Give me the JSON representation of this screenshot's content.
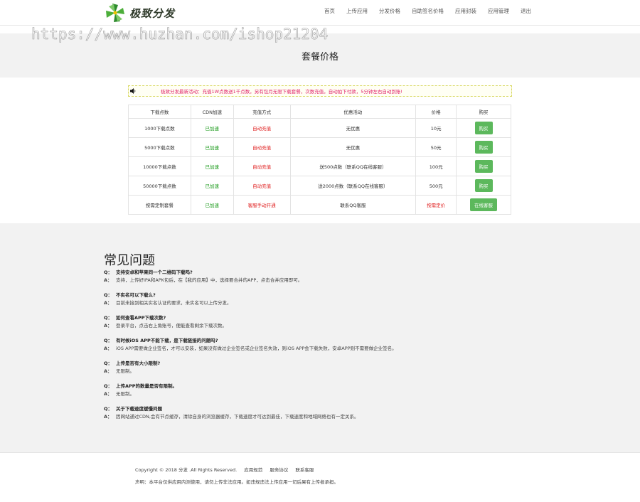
{
  "brand": {
    "logo_text": "极致分发"
  },
  "nav": {
    "items": [
      "首页",
      "上传应用",
      "分发价格",
      "自助签名价格",
      "应用封装",
      "应用管理",
      "退出"
    ]
  },
  "watermark": "https://www.huzhan.com/ishop21204",
  "page": {
    "title": "套餐价格"
  },
  "notice": "极致分发最新活动：充值1W点数送1千点数，另有包月无限下载套餐，次数充值，自动拍下付款，5分钟左右自动到账!",
  "table": {
    "headers": [
      "下载点数",
      "CDN加速",
      "充值方式",
      "优惠活动",
      "价格",
      "购买"
    ],
    "rows": [
      {
        "points": "1000下载点数",
        "cdn": "已加速",
        "method": "自动充值",
        "promo": "无优惠",
        "price": "10元",
        "action": "购买"
      },
      {
        "points": "5000下载点数",
        "cdn": "已加速",
        "method": "自动充值",
        "promo": "无优惠",
        "price": "50元",
        "action": "购买"
      },
      {
        "points": "10000下载点数",
        "cdn": "已加速",
        "method": "自动充值",
        "promo": "送500点数（联系QQ在线客服）",
        "price": "100元",
        "action": "购买"
      },
      {
        "points": "50000下载点数",
        "cdn": "已加速",
        "method": "自动充值",
        "promo": "送2000点数（联系QQ在线客服）",
        "price": "500元",
        "action": "购买"
      },
      {
        "points": "按需定制套餐",
        "cdn": "已加速",
        "method": "客服手动开通",
        "promo": "联系QQ客服",
        "price": "按需定价",
        "action": "在线客服"
      }
    ]
  },
  "faq": {
    "title": "常见问题",
    "q_tag": "Q：",
    "a_tag": "A：",
    "items": [
      {
        "q": "支持安卓和苹果同一个二维码下载吗?",
        "a": "支持，上传好IPA和APK包后，在【我的应用】中，选择要合并的APP，点击合并应用即可。"
      },
      {
        "q": "不实名可以下载么?",
        "a": "目前未接到相关实名认证的要求，未实名可以上传分发。"
      },
      {
        "q": "如何查看APP下载次数?",
        "a": "登录平台，点击右上角账号，便能查看剩余下载次数。"
      },
      {
        "q": "有时候iOS APP不能下载，是下载链接的问题吗?",
        "a": "iOS APP需要做企业签名，才可以安装，如果没有做过企业签名或企业签名失效，则iOS APP会下载失败，安卓APP则不需要做企业签名。"
      },
      {
        "q": "上传是否有大小限制?",
        "a": "无限制。"
      },
      {
        "q": "上传APP的数量是否有限制。",
        "a": "无限制。"
      },
      {
        "q": "关于下载速度缓慢问题",
        "a": "因网站通过CDN,会有节点缓存，清除自身的浏览器缓存，下载速度才可达到最佳，下载速度和地域网络也有一定关系。"
      }
    ]
  },
  "footer": {
    "copyright": "Copyright © 2018 分发 .All Rights Reserved.",
    "links": [
      "应用规范",
      "服务协议",
      "联系客服"
    ],
    "disclaimer": "声明：本平台仅供应用内测使用，请勿上传非法应用。如违规违法上传应用一切后果有上传者承担。"
  },
  "colors": {
    "accent_green": "#5cb85c",
    "notice_text": "#e0246a",
    "status_green": "#1a9a1a",
    "status_red": "#e02020"
  }
}
